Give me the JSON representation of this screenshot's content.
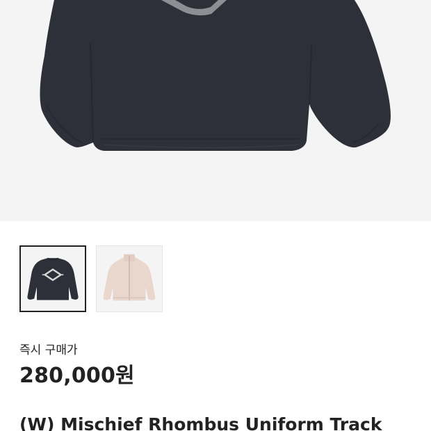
{
  "product": {
    "main_image": "navy-track-jacket-back-photo",
    "thumbnails": [
      {
        "name": "navy-track-jacket-back-thumbnail",
        "color": "#2d3039",
        "selected": true
      },
      {
        "name": "pink-track-jacket-front-thumbnail",
        "color": "#e9d6cc",
        "selected": false
      }
    ],
    "price_label": "즉시 구매가",
    "price": "280,000원",
    "title": "(W) Mischief Rhombus Uniform Track"
  },
  "colors": {
    "background": "#ffffff",
    "image_background": "#f4f4f4",
    "text": "#222222",
    "jacket_navy": "#2d3039",
    "jacket_pink": "#e9d6cc"
  }
}
